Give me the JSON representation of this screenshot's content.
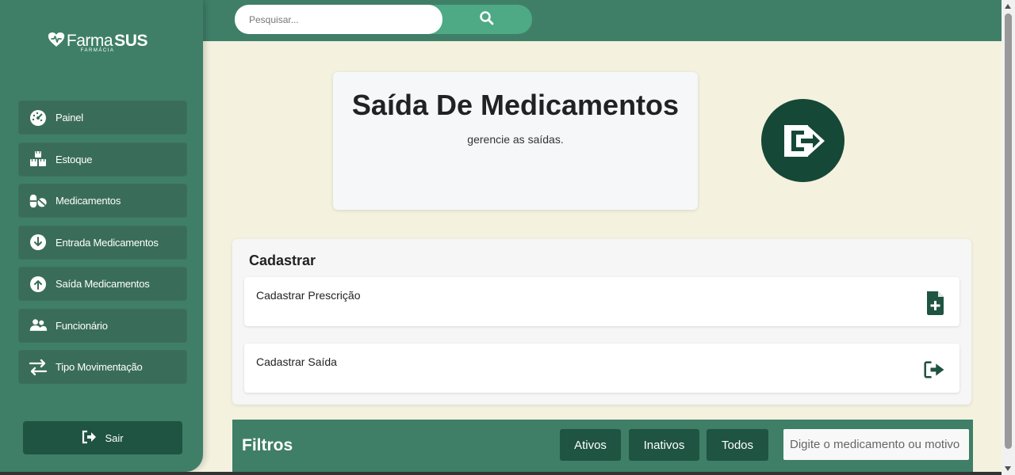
{
  "brand": {
    "name": "Farma",
    "highlight": "SUS",
    "subtitle": "FARMÁCIA"
  },
  "search": {
    "placeholder": "Pesquisar..."
  },
  "sidebar": {
    "items": [
      {
        "label": "Painel",
        "icon": "dashboard-icon"
      },
      {
        "label": "Estoque",
        "icon": "boxes-icon"
      },
      {
        "label": "Medicamentos",
        "icon": "pills-icon"
      },
      {
        "label": "Entrada Medicamentos",
        "icon": "arrow-down-circle-icon"
      },
      {
        "label": "Saída Medicamentos",
        "icon": "arrow-up-circle-icon"
      },
      {
        "label": "Funcionário",
        "icon": "users-icon"
      },
      {
        "label": "Tipo Movimentação",
        "icon": "swap-arrows-icon"
      }
    ],
    "logout_label": "Sair"
  },
  "hero": {
    "title": "Saída De Medicamentos",
    "subtitle": "gerencie as saídas."
  },
  "register": {
    "title": "Cadastrar",
    "items": [
      {
        "label": "Cadastrar Prescrição",
        "icon": "file-plus-icon"
      },
      {
        "label": "Cadastrar Saída",
        "icon": "exit-icon"
      }
    ]
  },
  "filters": {
    "title": "Filtros",
    "buttons": [
      "Ativos",
      "Inativos",
      "Todos"
    ],
    "search_placeholder": "Digite o medicamento ou motivo"
  },
  "colors": {
    "primary_green": "#3f7f68",
    "dark_green": "#1f5342",
    "background": "#f4f2df"
  }
}
